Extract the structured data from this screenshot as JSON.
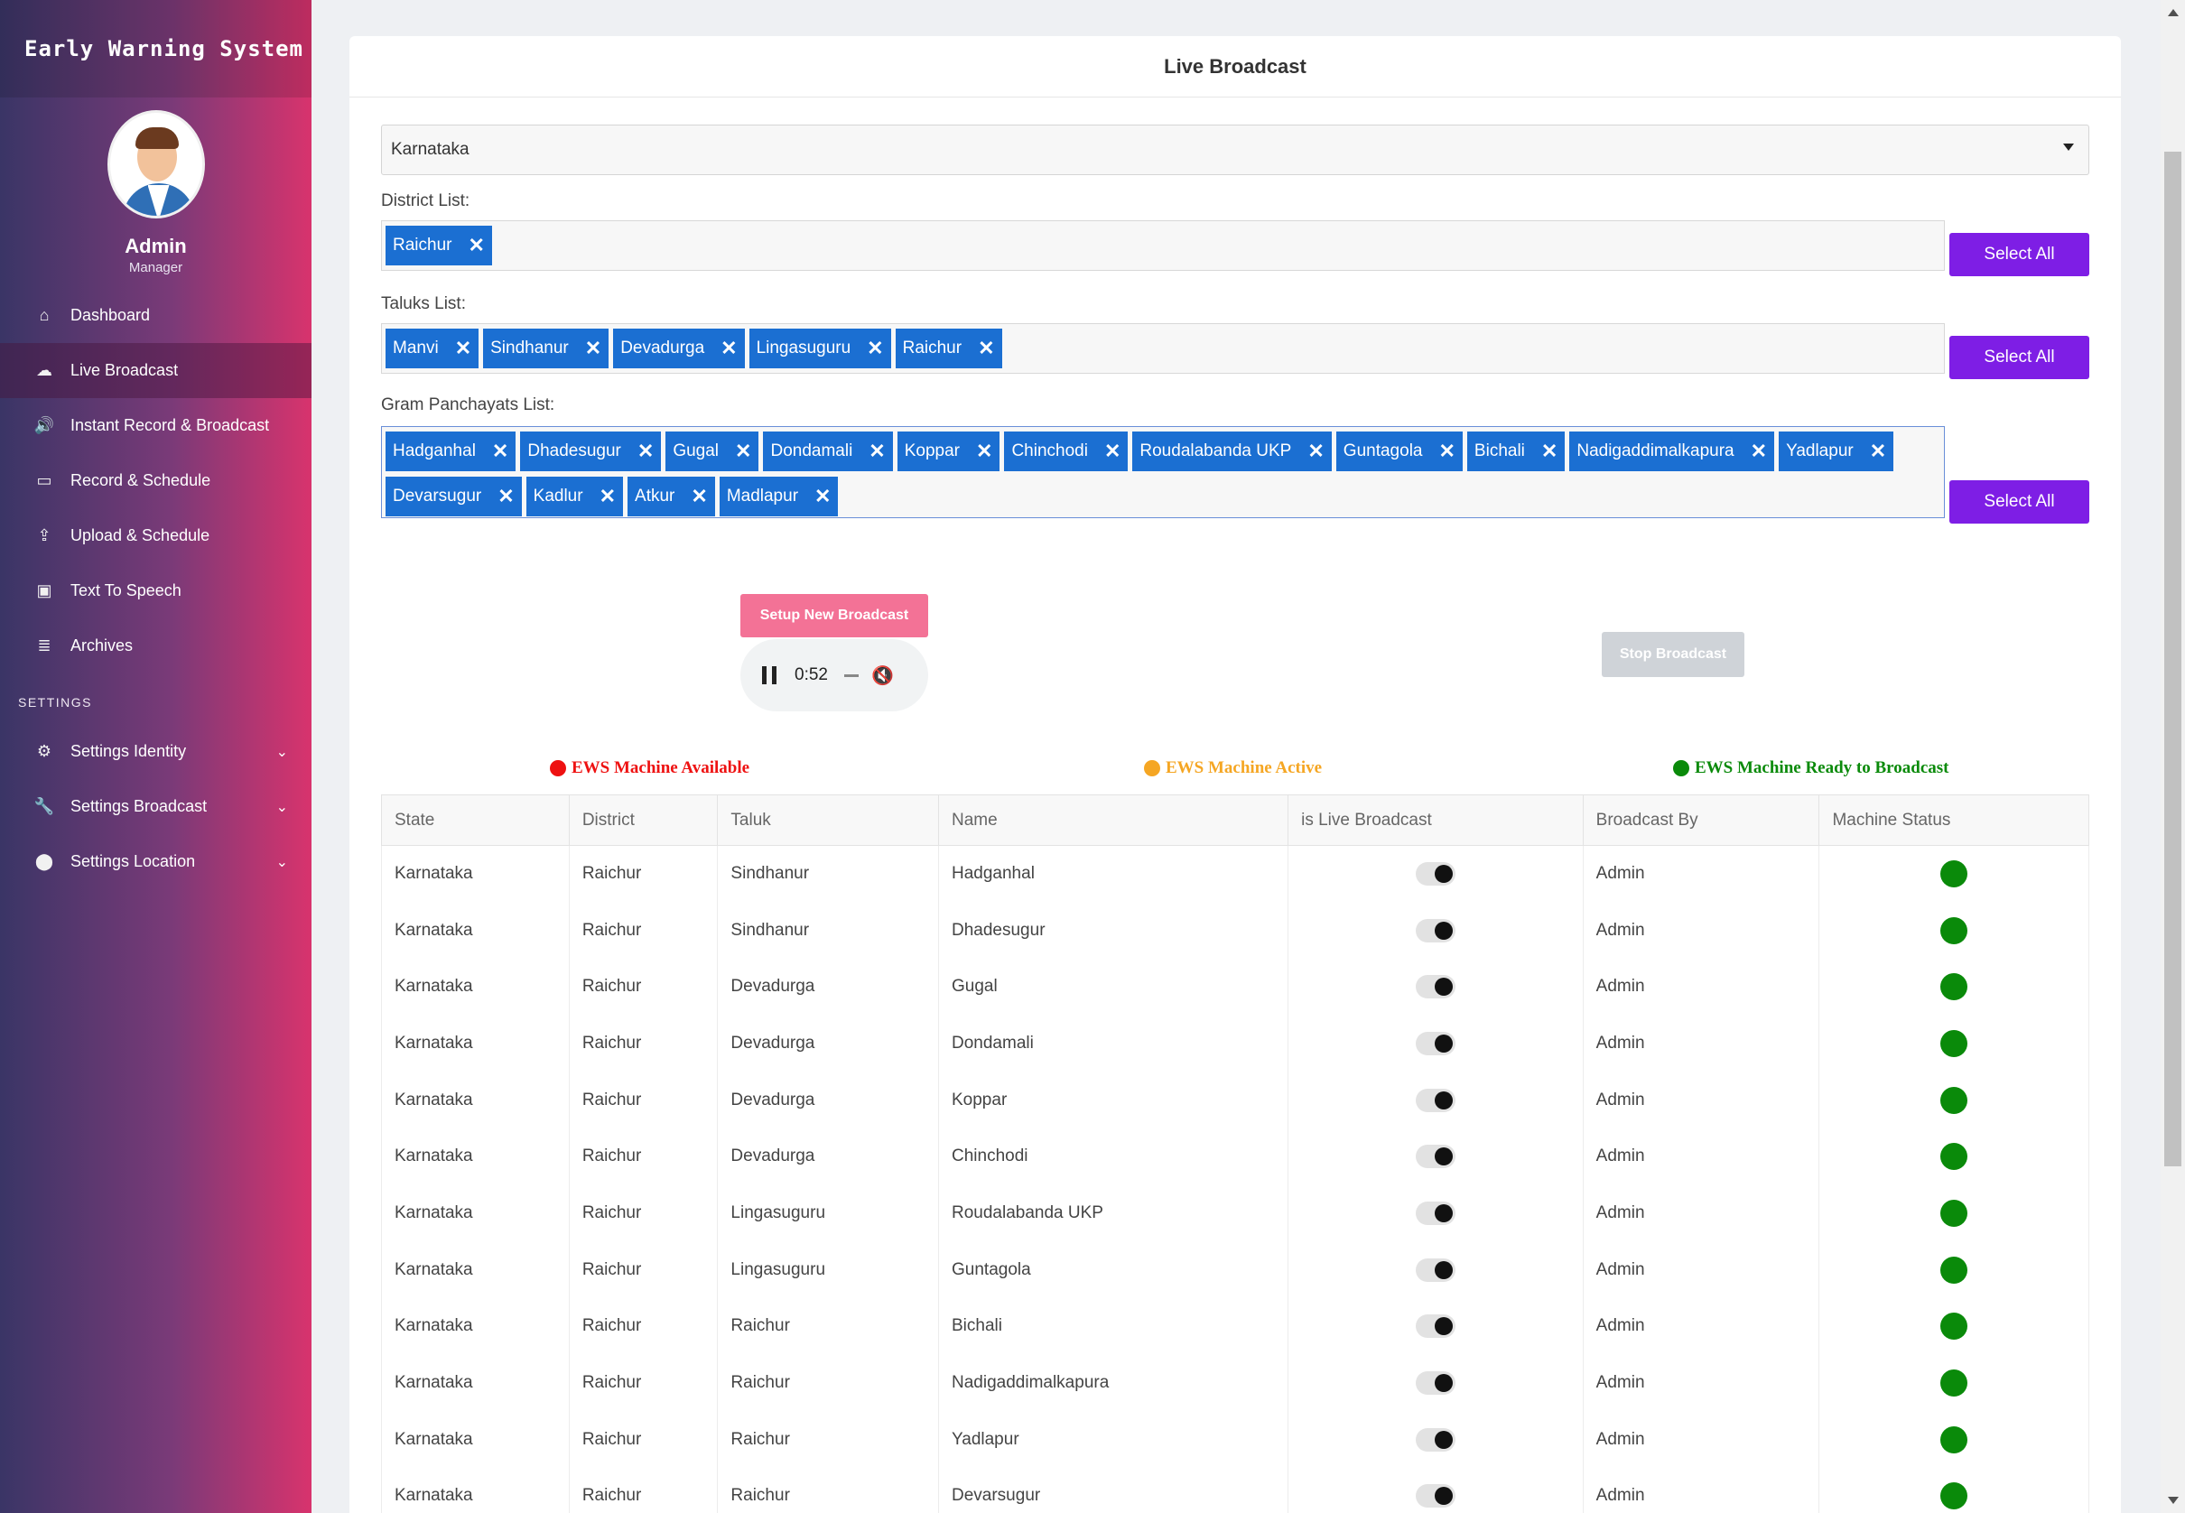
{
  "app": {
    "brand": "Early Warning System"
  },
  "profile": {
    "name": "Admin",
    "role": "Manager"
  },
  "nav": [
    {
      "label": "Dashboard",
      "icon": "home-icon",
      "glyph": "⌂"
    },
    {
      "label": "Live Broadcast",
      "icon": "cloud-icon",
      "glyph": "☁",
      "active": true
    },
    {
      "label": "Instant Record & Broadcast",
      "icon": "speaker-icon",
      "glyph": "🔊"
    },
    {
      "label": "Record & Schedule",
      "icon": "monitor-icon",
      "glyph": "▭"
    },
    {
      "label": "Upload & Schedule",
      "icon": "upload-icon",
      "glyph": "⇪"
    },
    {
      "label": "Text To Speech",
      "icon": "audio-description-icon",
      "glyph": "▣"
    },
    {
      "label": "Archives",
      "icon": "database-icon",
      "glyph": "≣"
    }
  ],
  "settings_heading": "SETTINGS",
  "settings_nav": [
    {
      "label": "Settings Identity",
      "icon": "cogs-icon",
      "glyph": "⚙"
    },
    {
      "label": "Settings Broadcast",
      "icon": "wrench-icon",
      "glyph": "🔧"
    },
    {
      "label": "Settings Location",
      "icon": "map-marker-icon",
      "glyph": "⬤"
    }
  ],
  "page": {
    "title": "Live Broadcast"
  },
  "state_select": {
    "value": "Karnataka"
  },
  "district": {
    "label": "District List:",
    "tags": [
      "Raichur"
    ]
  },
  "taluks": {
    "label": "Taluks List:",
    "tags": [
      "Manvi",
      "Sindhanur",
      "Devadurga",
      "Lingasuguru",
      "Raichur"
    ]
  },
  "gram_panchayats": {
    "label": "Gram Panchayats List:",
    "tags": [
      "Hadganhal",
      "Dhadesugur",
      "Gugal",
      "Dondamali",
      "Koppar",
      "Chinchodi",
      "Roudalabanda UKP",
      "Guntagola",
      "Bichali",
      "Nadigaddimalkapura",
      "Yadlapur",
      "Devarsugur",
      "Kadlur",
      "Atkur",
      "Madlapur"
    ]
  },
  "select_all_label": "Select All",
  "setup_button": "Setup New Broadcast",
  "stop_button": "Stop Broadcast",
  "player": {
    "time": "0:52"
  },
  "legend": [
    {
      "label": "EWS Machine Available",
      "color": "#ee1111"
    },
    {
      "label": "EWS Machine Active",
      "color": "#f5a623"
    },
    {
      "label": "EWS Machine Ready to Broadcast",
      "color": "#0a8a0a"
    }
  ],
  "table": {
    "headers": [
      "State",
      "District",
      "Taluk",
      "Name",
      "is Live Broadcast",
      "Broadcast By",
      "Machine Status"
    ],
    "rows": [
      [
        "Karnataka",
        "Raichur",
        "Sindhanur",
        "Hadganhal",
        "",
        "Admin",
        ""
      ],
      [
        "Karnataka",
        "Raichur",
        "Sindhanur",
        "Dhadesugur",
        "",
        "Admin",
        ""
      ],
      [
        "Karnataka",
        "Raichur",
        "Devadurga",
        "Gugal",
        "",
        "Admin",
        ""
      ],
      [
        "Karnataka",
        "Raichur",
        "Devadurga",
        "Dondamali",
        "",
        "Admin",
        ""
      ],
      [
        "Karnataka",
        "Raichur",
        "Devadurga",
        "Koppar",
        "",
        "Admin",
        ""
      ],
      [
        "Karnataka",
        "Raichur",
        "Devadurga",
        "Chinchodi",
        "",
        "Admin",
        ""
      ],
      [
        "Karnataka",
        "Raichur",
        "Lingasuguru",
        "Roudalabanda UKP",
        "",
        "Admin",
        ""
      ],
      [
        "Karnataka",
        "Raichur",
        "Lingasuguru",
        "Guntagola",
        "",
        "Admin",
        ""
      ],
      [
        "Karnataka",
        "Raichur",
        "Raichur",
        "Bichali",
        "",
        "Admin",
        ""
      ],
      [
        "Karnataka",
        "Raichur",
        "Raichur",
        "Nadigaddimalkapura",
        "",
        "Admin",
        ""
      ],
      [
        "Karnataka",
        "Raichur",
        "Raichur",
        "Yadlapur",
        "",
        "Admin",
        ""
      ],
      [
        "Karnataka",
        "Raichur",
        "Raichur",
        "Devarsugur",
        "",
        "Admin",
        ""
      ]
    ]
  }
}
